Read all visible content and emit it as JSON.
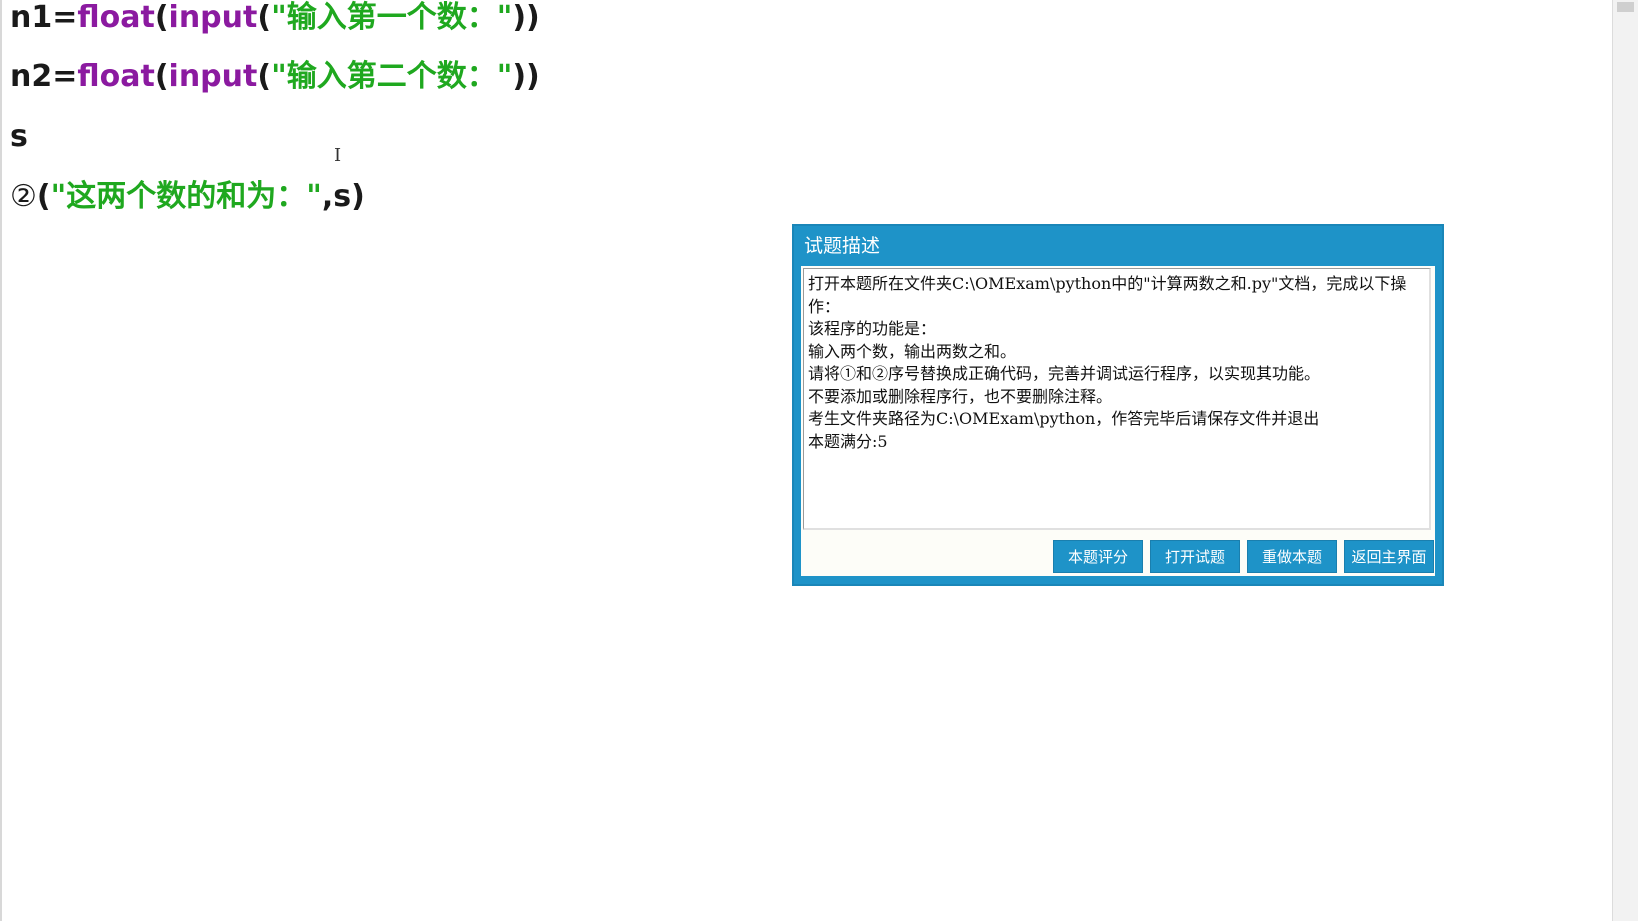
{
  "editor": {
    "line1": {
      "var": "n1=",
      "func1": "float",
      "paren1": "(",
      "func2": "input",
      "paren2": "(",
      "string": "\"输入第一个数：\"",
      "close": "))"
    },
    "line2": {
      "var": "n2=",
      "func1": "float",
      "paren1": "(",
      "func2": "input",
      "paren2": "(",
      "string": "\"输入第二个数：\"",
      "close": "))"
    },
    "line3": {
      "text": "s"
    },
    "line4": {
      "marker": "②",
      "open": "(",
      "string": "\"这两个数的和为：\"",
      "rest": ",s)"
    },
    "caret_glyph": "I"
  },
  "dialog": {
    "title": "试题描述",
    "description_lines": [
      "打开本题所在文件夹C:\\OMExam\\python中的\"计算两数之和.py\"文档，完成以下操",
      "作：",
      "该程序的功能是：",
      "输入两个数，输出两数之和。",
      "请将①和②序号替换成正确代码，完善并调试运行程序，以实现其功能。",
      "不要添加或删除程序行，也不要删除注释。",
      "考生文件夹路径为C:\\OMExam\\python，作答完毕后请保存文件并退出",
      "本题满分:5"
    ],
    "buttons": {
      "score": "本题评分",
      "open": "打开试题",
      "redo": "重做本题",
      "back": "返回主界面"
    }
  },
  "colors": {
    "dialog_blue": "#1e93c8",
    "code_purple": "#8b1aa0",
    "code_green": "#1fa81f"
  }
}
